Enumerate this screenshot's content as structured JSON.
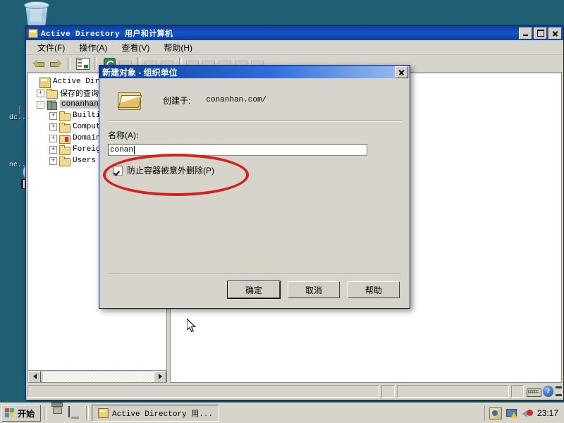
{
  "desktop": {
    "icons": [
      {
        "name": "recycle-bin",
        "label": ""
      },
      {
        "name": "dcp-document",
        "label": "dc..."
      },
      {
        "name": "network-recycle",
        "label": "ne..."
      }
    ]
  },
  "window": {
    "title": "Active Directory 用户和计算机",
    "icon": "console-icon",
    "controls": {
      "minimize": "minimize",
      "maximize": "maximize",
      "close": "close"
    },
    "menu": [
      "文件(F)",
      "操作(A)",
      "查看(V)",
      "帮助(H)"
    ],
    "toolbar": {
      "back": "back-arrow",
      "forward": "forward-arrow",
      "show_tree": "show-tree-icon",
      "refresh": "refresh-icon"
    },
    "tree": [
      {
        "label": "Active Direct",
        "icon": "console",
        "expander": "",
        "indent": 0,
        "selected": false
      },
      {
        "label": "保存的查询",
        "icon": "folder",
        "expander": "+",
        "indent": 1,
        "selected": false
      },
      {
        "label": "conanhan.c",
        "icon": "domain",
        "expander": "-",
        "indent": 1,
        "selected": true
      },
      {
        "label": "Builtin",
        "icon": "folder",
        "expander": "+",
        "indent": 2,
        "selected": false
      },
      {
        "label": "Compute",
        "icon": "folder",
        "expander": "+",
        "indent": 2,
        "selected": false
      },
      {
        "label": "Domain",
        "icon": "secfolder",
        "expander": "+",
        "indent": 2,
        "selected": false
      },
      {
        "label": "Foreign",
        "icon": "folder",
        "expander": "+",
        "indent": 2,
        "selected": false
      },
      {
        "label": "Users",
        "icon": "folder",
        "expander": "+",
        "indent": 2,
        "selected": false
      }
    ],
    "statusbar": {
      "keyboard": "keyboard-icon",
      "help": "?",
      "spinner": "spin-icon"
    }
  },
  "dialog": {
    "title": "新建对象 - 组织单位",
    "close_label": "✕",
    "icon": "ou-folder-icon",
    "created_in_label": "创建于:",
    "created_in_value": "conanhan.com/",
    "name_label": "名称(A):",
    "name_value": "conan",
    "protect_checkbox": {
      "label": "防止容器被意外删除(P)",
      "checked": true
    },
    "buttons": {
      "ok": "确定",
      "cancel": "取消",
      "help": "帮助"
    }
  },
  "annotation": {
    "shape": "red-ellipse",
    "color": "#d4211b"
  },
  "taskbar": {
    "start": "开始",
    "quick_launch": [
      "network-icon",
      "show-desktop-icon"
    ],
    "tasks": [
      {
        "label": "Active Directory 用...",
        "icon": "console-icon"
      }
    ],
    "tray": [
      "display-icon",
      "network-warning-icon",
      "volume-muted-icon"
    ],
    "clock": "23:17"
  }
}
